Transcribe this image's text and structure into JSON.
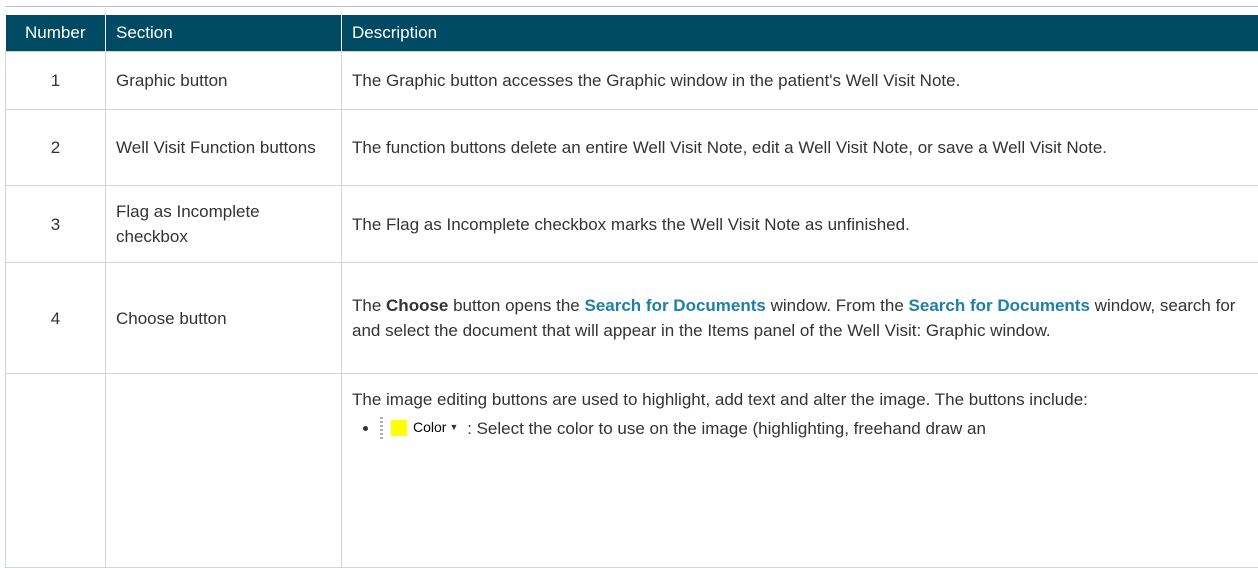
{
  "table": {
    "headers": {
      "number": "Number",
      "section": "Section",
      "description": "Description"
    },
    "rows": [
      {
        "number": "1",
        "section": "Graphic button",
        "description": "The Graphic button accesses the Graphic window in the patient's Well Visit Note."
      },
      {
        "number": "2",
        "section": "Well Visit Function buttons",
        "description": "The function buttons delete an entire Well Visit Note, edit a Well Visit Note, or save a Well Visit Note."
      },
      {
        "number": "3",
        "section": "Flag as Incomplete checkbox",
        "description": "The Flag as Incomplete checkbox marks the Well Visit Note as unfinished."
      },
      {
        "number": "4",
        "section": "Choose button",
        "description": {
          "p1": "The ",
          "choose": "Choose",
          "p2": " button opens the ",
          "link1": "Search for Documents",
          "p3": " window. From the ",
          "link2": "Search for Documents",
          "p4": " window, search for and select the document that will appear in the Items panel of the Well Visit: Graphic window."
        }
      },
      {
        "number": "",
        "section": "",
        "description": {
          "intro": "The image editing buttons are used to highlight, add text and alter the image.  The buttons include:",
          "items": [
            {
              "button_label": "Color",
              "button_icon": "color-swatch-icon",
              "swatch_color": "#ffff00",
              "text": ": Select the color to use on the image (highlighting, freehand draw an"
            }
          ]
        }
      }
    ]
  }
}
